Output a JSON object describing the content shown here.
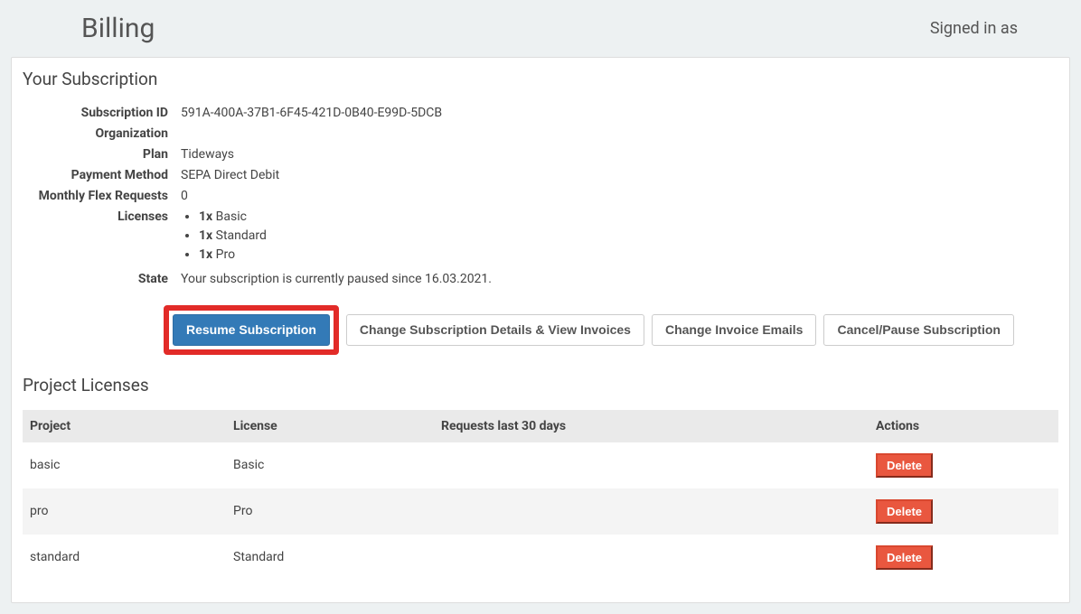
{
  "header": {
    "title": "Billing",
    "signed_in_text": "Signed in as"
  },
  "subscription": {
    "heading": "Your Subscription",
    "labels": {
      "subscription_id": "Subscription ID",
      "organization": "Organization",
      "plan": "Plan",
      "payment_method": "Payment Method",
      "monthly_flex_requests": "Monthly Flex Requests",
      "licenses": "Licenses",
      "state": "State"
    },
    "values": {
      "subscription_id": "591A-400A-37B1-6F45-421D-0B40-E99D-5DCB",
      "organization": "",
      "plan": "Tideways",
      "payment_method": "SEPA Direct Debit",
      "monthly_flex_requests": "0",
      "state": "Your subscription is currently paused since 16.03.2021."
    },
    "license_items": [
      {
        "qty": "1x",
        "name": "Basic"
      },
      {
        "qty": "1x",
        "name": "Standard"
      },
      {
        "qty": "1x",
        "name": "Pro"
      }
    ],
    "buttons": {
      "resume": "Resume Subscription",
      "change_details": "Change Subscription Details & View Invoices",
      "change_emails": "Change Invoice Emails",
      "cancel_pause": "Cancel/Pause Subscription"
    }
  },
  "project_licenses": {
    "heading": "Project Licenses",
    "columns": {
      "project": "Project",
      "license": "License",
      "requests": "Requests last 30 days",
      "actions": "Actions"
    },
    "delete_label": "Delete",
    "rows": [
      {
        "project": "basic",
        "license": "Basic",
        "requests": ""
      },
      {
        "project": "pro",
        "license": "Pro",
        "requests": ""
      },
      {
        "project": "standard",
        "license": "Standard",
        "requests": ""
      }
    ]
  }
}
